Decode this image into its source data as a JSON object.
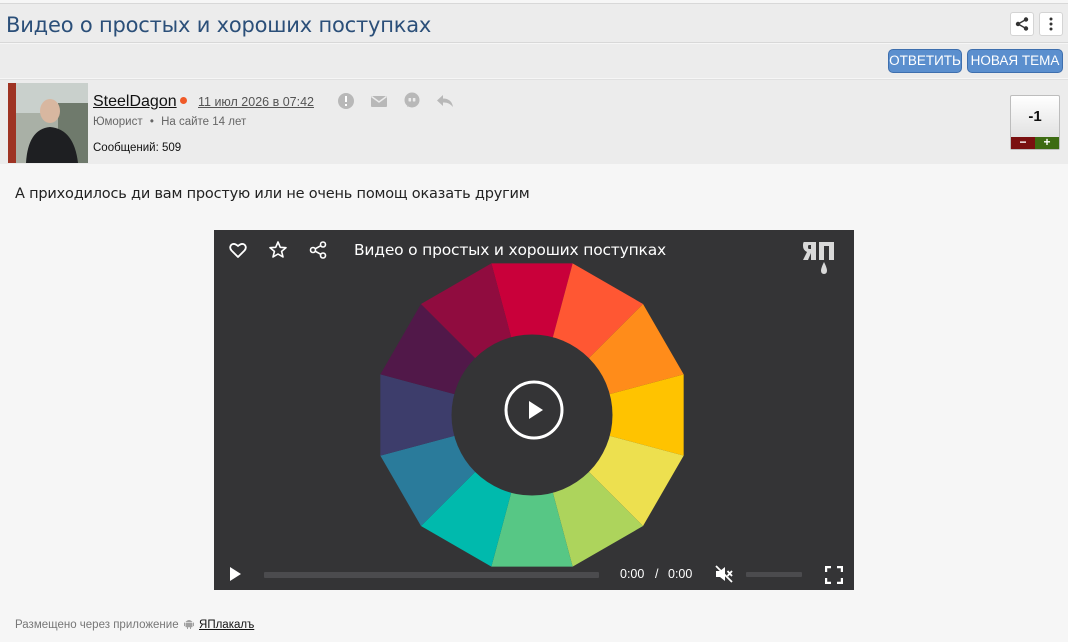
{
  "topic": {
    "title": "Видео о простых и хороших поступках"
  },
  "actions": {
    "reply_label": "ОТВЕТИТЬ",
    "new_topic_label": "НОВАЯ ТЕМА"
  },
  "post": {
    "author": "SteelDagon",
    "date": "11 июл 2026 в 07:42",
    "rank": "Юморист",
    "separator": "•",
    "on_site": "На сайте 14 лет",
    "messages": "Сообщений: 509",
    "rating": "-1",
    "rate_minus": "−",
    "rate_plus": "+",
    "text": "А приходилось ди вам простую или не очень помощ оказать другим"
  },
  "video": {
    "title": "Видео о простых и хороших поступках",
    "time_current": "0:00",
    "time_separator": "/",
    "time_duration": "0:00",
    "progress": 0,
    "muted": true
  },
  "footer": {
    "posted_via": "Размещено через приложение",
    "app_name": "ЯПлакалъ"
  },
  "colors": {
    "title_blue": "#2b4f79",
    "button_blue": "#5b8fce",
    "online_orange": "#f05a28",
    "video_bg": "#343436",
    "wheel": [
      "#c9003a",
      "#ff5733",
      "#ff8c1a",
      "#ffc300",
      "#ede04f",
      "#add45c",
      "#57c785",
      "#00baad",
      "#2a7b9b",
      "#3d3d6b",
      "#511849",
      "#900c3f"
    ]
  },
  "icons": [
    "share-icon",
    "more-vert-icon",
    "report-icon",
    "mail-icon",
    "quote-icon",
    "reply-icon",
    "heart-icon",
    "star-icon",
    "video-share-icon",
    "yap-logo-icon",
    "play-icon",
    "mute-icon",
    "fullscreen-icon",
    "android-icon"
  ]
}
